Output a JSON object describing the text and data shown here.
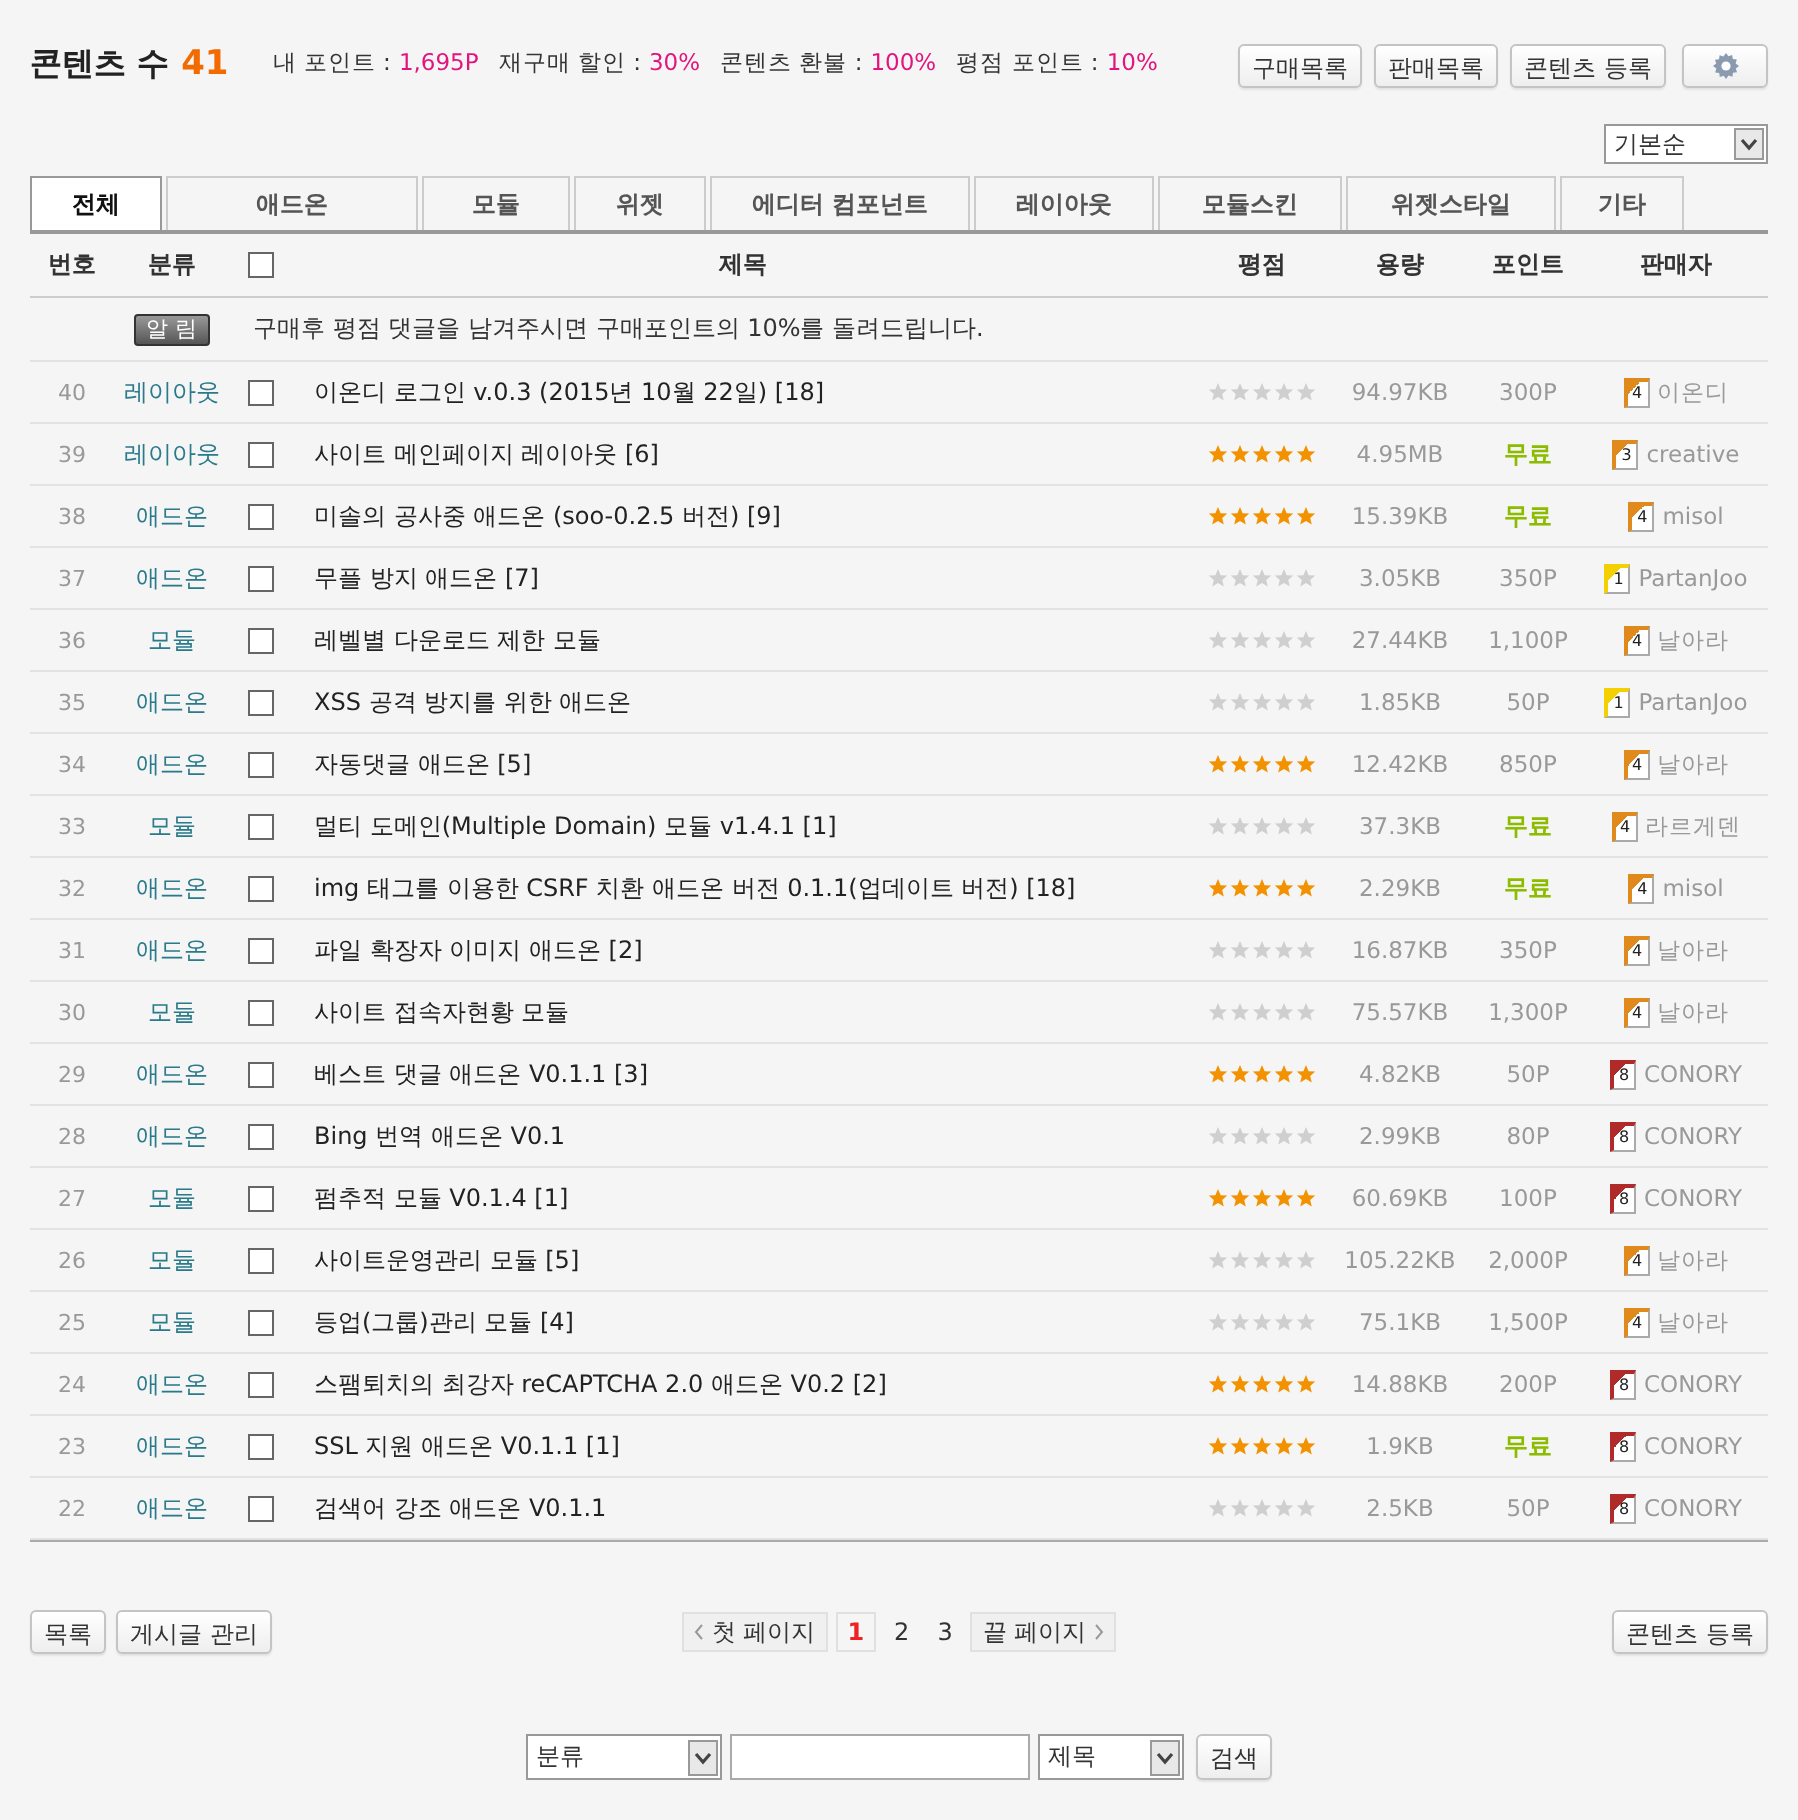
{
  "header": {
    "title": "콘텐츠 수",
    "count": "41",
    "stats": [
      {
        "label": "내 포인트 :",
        "value": "1,695P"
      },
      {
        "label": "재구매 할인 :",
        "value": "30%"
      },
      {
        "label": "콘텐츠 환불 :",
        "value": "100%"
      },
      {
        "label": "평점 포인트 :",
        "value": "10%"
      }
    ],
    "buttons": [
      "구매목록",
      "판매목록",
      "콘텐츠 등록"
    ]
  },
  "sort": {
    "value": "기본순"
  },
  "tabs": [
    {
      "label": "전체",
      "selected": true
    },
    {
      "label": "애드온",
      "selected": false
    },
    {
      "label": "모듈",
      "selected": false
    },
    {
      "label": "위젯",
      "selected": false
    },
    {
      "label": "에디터 컴포넌트",
      "selected": false
    },
    {
      "label": "레이아웃",
      "selected": false
    },
    {
      "label": "모듈스킨",
      "selected": false
    },
    {
      "label": "위젯스타일",
      "selected": false
    },
    {
      "label": "기타",
      "selected": false
    }
  ],
  "table": {
    "columns": [
      "번호",
      "분류",
      "제목",
      "평점",
      "용량",
      "포인트",
      "판매자"
    ],
    "select_all": {
      "checked": false
    },
    "notice": {
      "badge": "알 림",
      "text": "구매후 평점 댓글을 남겨주시면 구매포인트의 10%를 돌려드립니다."
    },
    "rows": [
      {
        "no": "40",
        "category": "레이아웃",
        "title": "이온디 로그인 v.0.3 (2015년 10월 22일) [18]",
        "checked": false,
        "stars": 0,
        "size": "94.97KB",
        "points": "300P",
        "free": false,
        "level": "4",
        "color": "#e08a1e",
        "seller": "이온디"
      },
      {
        "no": "39",
        "category": "레이아웃",
        "title": "사이트 메인페이지 레이아웃 [6]",
        "checked": false,
        "stars": 5,
        "size": "4.95MB",
        "points": "무료",
        "free": true,
        "level": "3",
        "color": "#e08a1e",
        "seller": "creative"
      },
      {
        "no": "38",
        "category": "애드온",
        "title": "미솔의 공사중 애드온 (soo-0.2.5 버전) [9]",
        "checked": false,
        "stars": 5,
        "size": "15.39KB",
        "points": "무료",
        "free": true,
        "level": "4",
        "color": "#e08a1e",
        "seller": "misol"
      },
      {
        "no": "37",
        "category": "애드온",
        "title": "무플 방지 애드온 [7]",
        "checked": false,
        "stars": 0,
        "size": "3.05KB",
        "points": "350P",
        "free": false,
        "level": "1",
        "color": "#f5d000",
        "seller": "PartanJoo"
      },
      {
        "no": "36",
        "category": "모듈",
        "title": "레벨별 다운로드 제한 모듈",
        "checked": false,
        "stars": 0,
        "size": "27.44KB",
        "points": "1,100P",
        "free": false,
        "level": "4",
        "color": "#e08a1e",
        "seller": "날아라"
      },
      {
        "no": "35",
        "category": "애드온",
        "title": "XSS 공격 방지를 위한 애드온",
        "checked": false,
        "stars": 0,
        "size": "1.85KB",
        "points": "50P",
        "free": false,
        "level": "1",
        "color": "#f5d000",
        "seller": "PartanJoo"
      },
      {
        "no": "34",
        "category": "애드온",
        "title": "자동댓글 애드온 [5]",
        "checked": false,
        "stars": 5,
        "size": "12.42KB",
        "points": "850P",
        "free": false,
        "level": "4",
        "color": "#e08a1e",
        "seller": "날아라"
      },
      {
        "no": "33",
        "category": "모듈",
        "title": "멀티 도메인(Multiple Domain) 모듈 v1.4.1 [1]",
        "checked": false,
        "stars": 0,
        "size": "37.3KB",
        "points": "무료",
        "free": true,
        "level": "4",
        "color": "#e08a1e",
        "seller": "라르게덴"
      },
      {
        "no": "32",
        "category": "애드온",
        "title": "img 태그를 이용한 CSRF 치환 애드온 버전 0.1.1(업데이트 버전) [18]",
        "checked": false,
        "stars": 5,
        "size": "2.29KB",
        "points": "무료",
        "free": true,
        "level": "4",
        "color": "#e08a1e",
        "seller": "misol"
      },
      {
        "no": "31",
        "category": "애드온",
        "title": "파일 확장자 이미지 애드온 [2]",
        "checked": false,
        "stars": 0,
        "size": "16.87KB",
        "points": "350P",
        "free": false,
        "level": "4",
        "color": "#e08a1e",
        "seller": "날아라"
      },
      {
        "no": "30",
        "category": "모듈",
        "title": "사이트 접속자현황 모듈",
        "checked": false,
        "stars": 0,
        "size": "75.57KB",
        "points": "1,300P",
        "free": false,
        "level": "4",
        "color": "#e08a1e",
        "seller": "날아라"
      },
      {
        "no": "29",
        "category": "애드온",
        "title": "베스트 댓글 애드온 V0.1.1 [3]",
        "checked": false,
        "stars": 5,
        "size": "4.82KB",
        "points": "50P",
        "free": false,
        "level": "8",
        "color": "#b02a2a",
        "seller": "CONORY"
      },
      {
        "no": "28",
        "category": "애드온",
        "title": "Bing 번역 애드온 V0.1",
        "checked": false,
        "stars": 0,
        "size": "2.99KB",
        "points": "80P",
        "free": false,
        "level": "8",
        "color": "#b02a2a",
        "seller": "CONORY"
      },
      {
        "no": "27",
        "category": "모듈",
        "title": "펌추적 모듈 V0.1.4 [1]",
        "checked": false,
        "stars": 5,
        "size": "60.69KB",
        "points": "100P",
        "free": false,
        "level": "8",
        "color": "#b02a2a",
        "seller": "CONORY"
      },
      {
        "no": "26",
        "category": "모듈",
        "title": "사이트운영관리 모듈 [5]",
        "checked": false,
        "stars": 0,
        "size": "105.22KB",
        "points": "2,000P",
        "free": false,
        "level": "4",
        "color": "#e08a1e",
        "seller": "날아라"
      },
      {
        "no": "25",
        "category": "모듈",
        "title": "등업(그룹)관리 모듈 [4]",
        "checked": false,
        "stars": 0,
        "size": "75.1KB",
        "points": "1,500P",
        "free": false,
        "level": "4",
        "color": "#e08a1e",
        "seller": "날아라"
      },
      {
        "no": "24",
        "category": "애드온",
        "title": "스팸퇴치의 최강자 reCAPTCHA 2.0 애드온 V0.2 [2]",
        "checked": false,
        "stars": 5,
        "size": "14.88KB",
        "points": "200P",
        "free": false,
        "level": "8",
        "color": "#b02a2a",
        "seller": "CONORY"
      },
      {
        "no": "23",
        "category": "애드온",
        "title": "SSL 지원 애드온 V0.1.1 [1]",
        "checked": false,
        "stars": 5,
        "size": "1.9KB",
        "points": "무료",
        "free": true,
        "level": "8",
        "color": "#b02a2a",
        "seller": "CONORY"
      },
      {
        "no": "22",
        "category": "애드온",
        "title": "검색어 강조 애드온 V0.1.1",
        "checked": false,
        "stars": 0,
        "size": "2.5KB",
        "points": "50P",
        "free": false,
        "level": "8",
        "color": "#b02a2a",
        "seller": "CONORY"
      }
    ]
  },
  "footer": {
    "left_buttons": [
      "목록",
      "게시글 관리"
    ],
    "right_button": "콘텐츠 등록",
    "pagination": {
      "first": "첫 페이지",
      "last": "끝 페이지",
      "pages": [
        {
          "label": "1",
          "selected": true
        },
        {
          "label": "2",
          "selected": false
        },
        {
          "label": "3",
          "selected": false
        }
      ]
    }
  },
  "search": {
    "category": "분류",
    "target": "제목",
    "button": "검색"
  }
}
